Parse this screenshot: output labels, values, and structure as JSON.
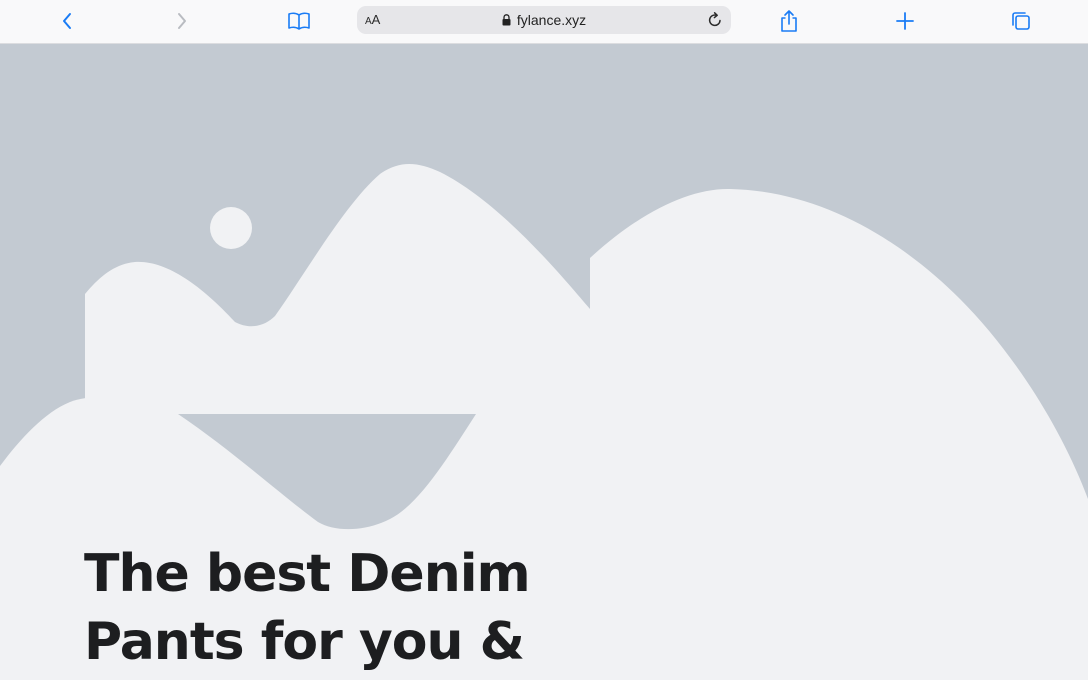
{
  "browser": {
    "back_icon": "chevron-left-icon",
    "forward_icon": "chevron-right-icon",
    "bookmarks_icon": "open-book-icon",
    "reader_label_small": "A",
    "reader_label_large": "A",
    "lock_icon": "lock-icon",
    "url": "fylance.xyz",
    "reload_icon": "reload-icon",
    "share_icon": "share-icon",
    "new_tab_icon": "plus-icon",
    "tabs_icon": "tabs-overview-icon",
    "accent_color": "#1a7cf5"
  },
  "hero": {
    "image_placeholder": "image-placeholder-illustration",
    "background_color": "#c3cad2",
    "shape_color": "#f1f2f4",
    "headline_line1": "The best Denim",
    "headline_line2": "Pants for you &"
  }
}
